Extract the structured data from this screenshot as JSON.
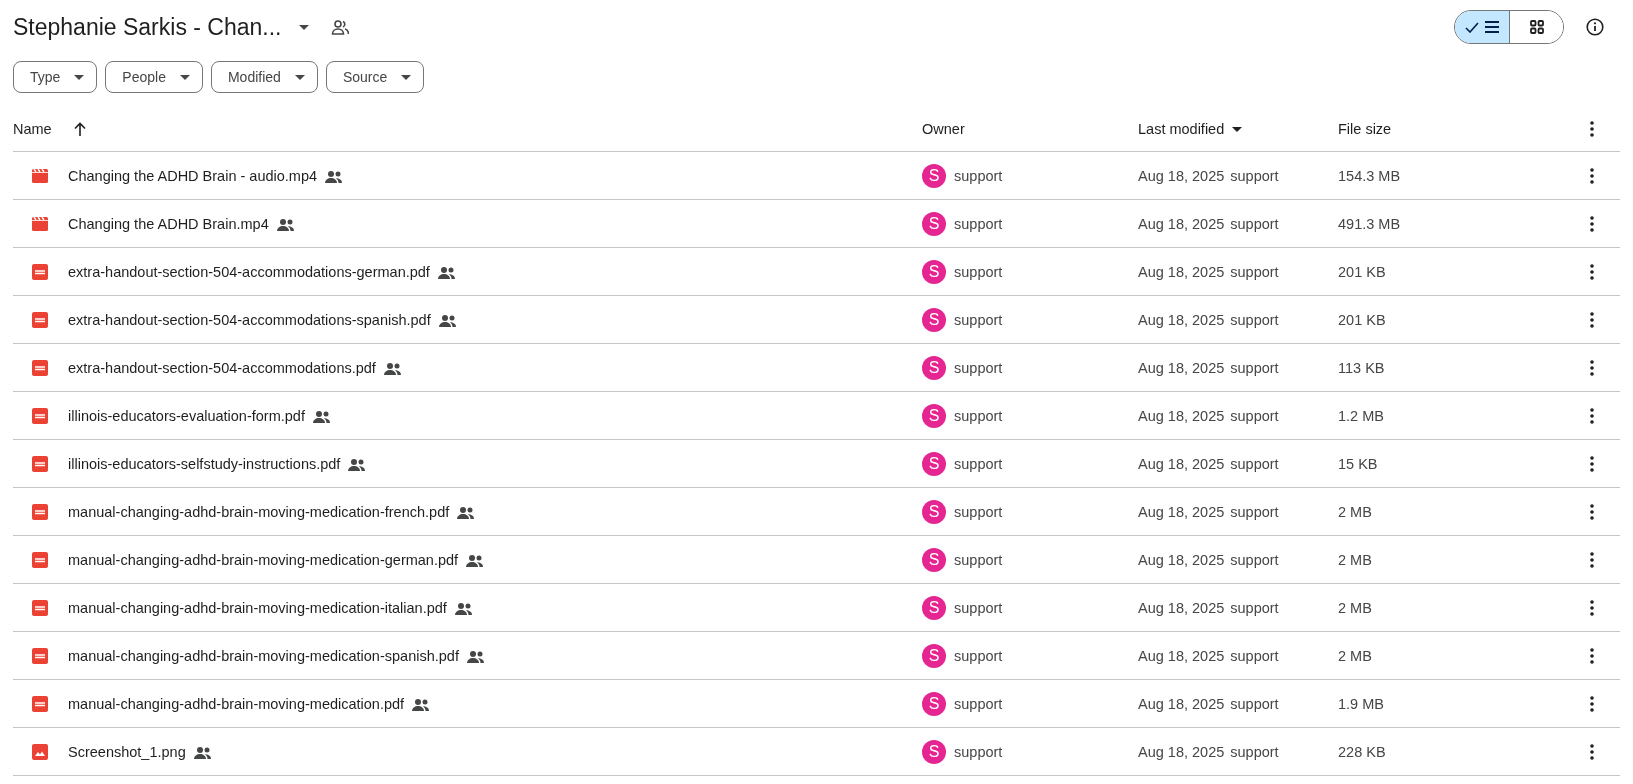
{
  "title": "Stephanie Sarkis - Chan...",
  "title_shared": true,
  "view_toggle": [
    {
      "kind": "list",
      "selected": true
    },
    {
      "kind": "grid",
      "selected": false
    }
  ],
  "filters": [
    "Type",
    "People",
    "Modified",
    "Source"
  ],
  "table": {
    "columns": [
      {
        "kind": "name",
        "label": "Name",
        "sort_arrow": true,
        "sort_caret": false
      },
      {
        "kind": "owner",
        "label": "Owner",
        "sort_arrow": false,
        "sort_caret": false
      },
      {
        "kind": "modified",
        "label": "Last modified",
        "sort_arrow": false,
        "sort_caret": true
      },
      {
        "kind": "size",
        "label": "File size",
        "sort_arrow": false,
        "sort_caret": false
      }
    ],
    "rows": [
      {
        "kind": "video",
        "name": "Changing the ADHD Brain - audio.mp4",
        "shared": true,
        "owner_initial": "S",
        "owner": "support",
        "modified": "Aug 18, 2025",
        "modified_by": "support",
        "size": "154.3 MB"
      },
      {
        "kind": "video",
        "name": "Changing the ADHD Brain.mp4",
        "shared": true,
        "owner_initial": "S",
        "owner": "support",
        "modified": "Aug 18, 2025",
        "modified_by": "support",
        "size": "491.3 MB"
      },
      {
        "kind": "pdf",
        "name": "extra-handout-section-504-accommodations-german.pdf",
        "shared": true,
        "owner_initial": "S",
        "owner": "support",
        "modified": "Aug 18, 2025",
        "modified_by": "support",
        "size": "201 KB"
      },
      {
        "kind": "pdf",
        "name": "extra-handout-section-504-accommodations-spanish.pdf",
        "shared": true,
        "owner_initial": "S",
        "owner": "support",
        "modified": "Aug 18, 2025",
        "modified_by": "support",
        "size": "201 KB"
      },
      {
        "kind": "pdf",
        "name": "extra-handout-section-504-accommodations.pdf",
        "shared": true,
        "owner_initial": "S",
        "owner": "support",
        "modified": "Aug 18, 2025",
        "modified_by": "support",
        "size": "113 KB"
      },
      {
        "kind": "pdf",
        "name": "illinois-educators-evaluation-form.pdf",
        "shared": true,
        "owner_initial": "S",
        "owner": "support",
        "modified": "Aug 18, 2025",
        "modified_by": "support",
        "size": "1.2 MB"
      },
      {
        "kind": "pdf",
        "name": "illinois-educators-selfstudy-instructions.pdf",
        "shared": true,
        "owner_initial": "S",
        "owner": "support",
        "modified": "Aug 18, 2025",
        "modified_by": "support",
        "size": "15 KB"
      },
      {
        "kind": "pdf",
        "name": "manual-changing-adhd-brain-moving-medication-french.pdf",
        "shared": true,
        "owner_initial": "S",
        "owner": "support",
        "modified": "Aug 18, 2025",
        "modified_by": "support",
        "size": "2 MB"
      },
      {
        "kind": "pdf",
        "name": "manual-changing-adhd-brain-moving-medication-german.pdf",
        "shared": true,
        "owner_initial": "S",
        "owner": "support",
        "modified": "Aug 18, 2025",
        "modified_by": "support",
        "size": "2 MB"
      },
      {
        "kind": "pdf",
        "name": "manual-changing-adhd-brain-moving-medication-italian.pdf",
        "shared": true,
        "owner_initial": "S",
        "owner": "support",
        "modified": "Aug 18, 2025",
        "modified_by": "support",
        "size": "2 MB"
      },
      {
        "kind": "pdf",
        "name": "manual-changing-adhd-brain-moving-medication-spanish.pdf",
        "shared": true,
        "owner_initial": "S",
        "owner": "support",
        "modified": "Aug 18, 2025",
        "modified_by": "support",
        "size": "2 MB"
      },
      {
        "kind": "pdf",
        "name": "manual-changing-adhd-brain-moving-medication.pdf",
        "shared": true,
        "owner_initial": "S",
        "owner": "support",
        "modified": "Aug 18, 2025",
        "modified_by": "support",
        "size": "1.9 MB"
      },
      {
        "kind": "image",
        "name": "Screenshot_1.png",
        "shared": true,
        "owner_initial": "S",
        "owner": "support",
        "modified": "Aug 18, 2025",
        "modified_by": "support",
        "size": "228 KB"
      }
    ]
  }
}
